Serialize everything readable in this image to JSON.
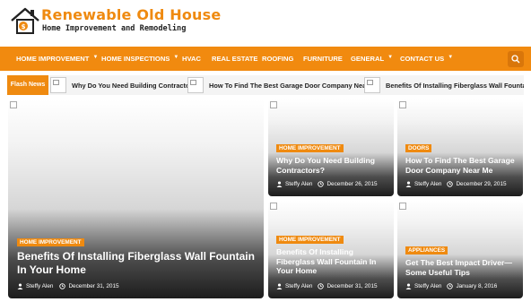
{
  "brand": {
    "title": "Renewable Old House",
    "tagline": "Home Improvement and Remodeling",
    "accent": "#f18a0f"
  },
  "nav": {
    "items": [
      {
        "label": "HOME IMPROVEMENT",
        "dropdown": true
      },
      {
        "label": "HOME INSPECTIONS",
        "dropdown": true
      },
      {
        "label": "HVAC",
        "dropdown": false
      },
      {
        "label": "REAL ESTATE",
        "dropdown": false
      },
      {
        "label": "ROOFING",
        "dropdown": false
      },
      {
        "label": "FURNITURE",
        "dropdown": false
      },
      {
        "label": "GENERAL",
        "dropdown": true
      },
      {
        "label": "CONTACT US",
        "dropdown": true
      }
    ],
    "search_icon": "search-icon"
  },
  "flash": {
    "label": "Flash News",
    "items": [
      {
        "text": "Why Do You Need Building Contractors?"
      },
      {
        "text": "How To Find The Best Garage Door Company Near Me"
      },
      {
        "text": "Benefits Of Installing Fiberglass Wall Fountain In Yo"
      }
    ]
  },
  "featured": {
    "category": "HOME IMPROVEMENT",
    "title": "Benefits Of Installing Fiberglass Wall Fountain In Your Home",
    "author": "Steffy Alen",
    "date": "December 31, 2015"
  },
  "cards": [
    {
      "category": "HOME IMPROVEMENT",
      "title": "Why Do You Need Building Contractors?",
      "author": "Steffy Alen",
      "date": "December 26, 2015"
    },
    {
      "category": "DOORS",
      "title": "How To Find The Best Garage Door Company Near Me",
      "author": "Steffy Alen",
      "date": "December 29, 2015"
    },
    {
      "category": "HOME IMPROVEMENT",
      "title": "Benefits Of Installing Fiberglass Wall Fountain In Your Home",
      "author": "Steffy Alen",
      "date": "December 31, 2015"
    },
    {
      "category": "APPLIANCES",
      "title": "Get The Best Impact Driver— Some Useful Tips",
      "author": "Steffy Alen",
      "date": "January 8, 2016"
    }
  ]
}
